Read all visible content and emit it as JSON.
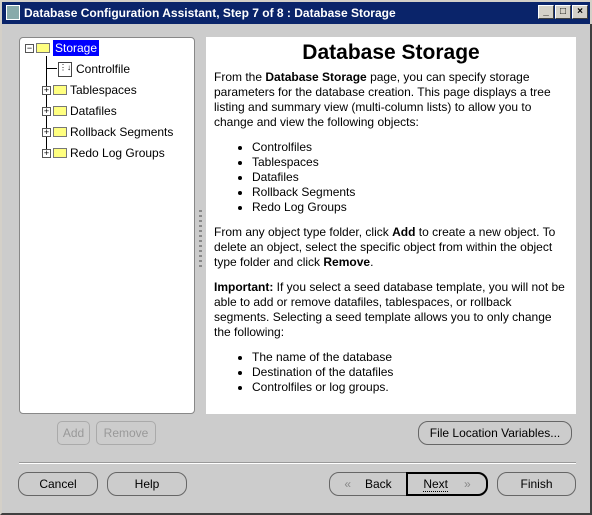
{
  "window": {
    "title": "Database Configuration Assistant, Step 7 of 8 : Database Storage",
    "min": "_",
    "max": "□",
    "close": "×"
  },
  "tree": {
    "root": "Storage",
    "items": [
      "Controlfile",
      "Tablespaces",
      "Datafiles",
      "Rollback Segments",
      "Redo Log Groups"
    ]
  },
  "help": {
    "title": "Database Storage",
    "p1_a": "From the ",
    "p1_b": "Database Storage",
    "p1_c": " page, you can specify storage parameters for the database creation. This page displays a tree listing and summary view (multi-column lists) to allow you to change and view the following objects:",
    "list1": [
      "Controlfiles",
      "Tablespaces",
      "Datafiles",
      "Rollback Segments",
      "Redo Log Groups"
    ],
    "p2_a": "From any object type folder, click ",
    "p2_b": "Add",
    "p2_c": " to create a new object. To delete an object, select the specific object from within the object type folder and click ",
    "p2_d": "Remove",
    "p2_e": ".",
    "p3_a": "Important:",
    "p3_b": " If you select a seed database template, you will not be able to add or remove datafiles, tablespaces, or rollback segments. Selecting a seed template allows you to only change the following:",
    "list2": [
      "The name of the database",
      "Destination of the datafiles",
      "Controlfiles or log groups."
    ]
  },
  "buttons": {
    "add": "Add",
    "remove": "Remove",
    "file_location": "File Location Variables...",
    "cancel": "Cancel",
    "help": "Help",
    "back": "Back",
    "next": "Next",
    "finish": "Finish"
  }
}
